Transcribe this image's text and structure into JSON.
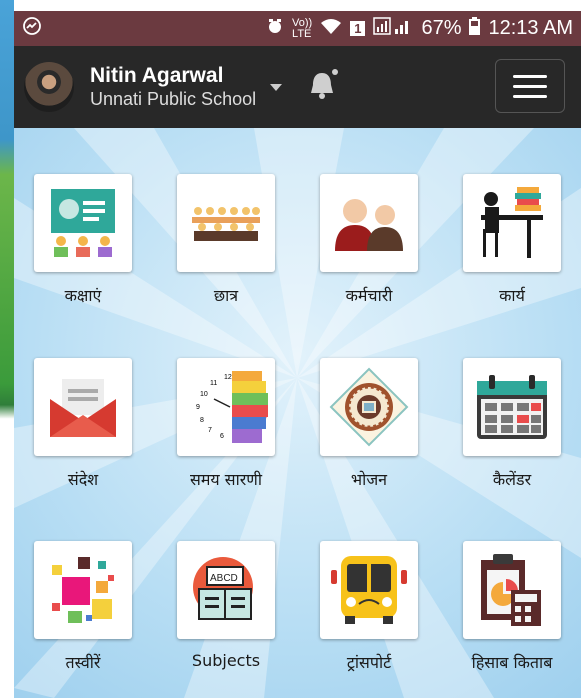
{
  "status": {
    "network_label_top": "Vo))",
    "network_label_bottom": "LTE",
    "sim_badge": "1",
    "battery": "67%",
    "time": "12:13 AM"
  },
  "header": {
    "user_name": "Nitin Agarwal",
    "school": "Unnati Public School"
  },
  "grid": [
    {
      "label": "कक्षाएं"
    },
    {
      "label": "छात्र"
    },
    {
      "label": "कर्मचारी"
    },
    {
      "label": "कार्य"
    },
    {
      "label": "संदेश"
    },
    {
      "label": "समय सारणी"
    },
    {
      "label": "भोजन"
    },
    {
      "label": "कैलेंडर"
    },
    {
      "label": "तस्वीरें"
    },
    {
      "label": "Subjects"
    },
    {
      "label": "ट्रांसपोर्ट"
    },
    {
      "label": "हिसाब किताब"
    }
  ],
  "icon_text": {
    "clock_12": "12",
    "clock_11": "11",
    "clock_10": "10",
    "clock_9": "9",
    "clock_8": "8",
    "clock_7": "7",
    "clock_6": "6",
    "book_abcd": "ABCD"
  },
  "colors": {
    "status_bar": "#6b3a40",
    "header": "#282828",
    "tile_bg": "#ffffff"
  }
}
